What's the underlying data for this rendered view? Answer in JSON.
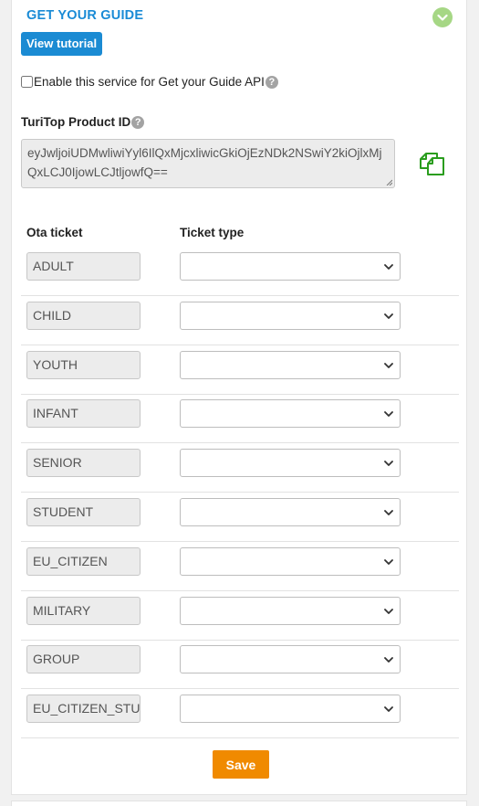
{
  "header": {
    "title": "GET YOUR GUIDE",
    "status_icon": "check-circle-icon",
    "accent_color": "#1a8bd6"
  },
  "tutorial_button": {
    "label": "View tutorial"
  },
  "enable_service": {
    "label": "Enable this service for Get your Guide API",
    "checked": false
  },
  "product_id": {
    "label": "TuriTop Product ID",
    "value": "eyJwljoiUDMwliwiYyl6IlQxMjcxliwicGkiOjEzNDk2NSwiY2kiOjlxMjQxLCJ0IjowLCJtljowfQ==",
    "copy_icon": "copy-icon"
  },
  "table": {
    "headers": {
      "ota_ticket": "Ota ticket",
      "ticket_type": "Ticket type"
    },
    "rows": [
      {
        "ota_ticket": "ADULT",
        "ticket_type": ""
      },
      {
        "ota_ticket": "CHILD",
        "ticket_type": ""
      },
      {
        "ota_ticket": "YOUTH",
        "ticket_type": ""
      },
      {
        "ota_ticket": "INFANT",
        "ticket_type": ""
      },
      {
        "ota_ticket": "SENIOR",
        "ticket_type": ""
      },
      {
        "ota_ticket": "STUDENT",
        "ticket_type": ""
      },
      {
        "ota_ticket": "EU_CITIZEN",
        "ticket_type": ""
      },
      {
        "ota_ticket": "MILITARY",
        "ticket_type": ""
      },
      {
        "ota_ticket": "GROUP",
        "ticket_type": ""
      },
      {
        "ota_ticket": "EU_CITIZEN_STUDENT",
        "ticket_type": ""
      }
    ]
  },
  "save_button": {
    "label": "Save",
    "color": "#f08a00"
  }
}
